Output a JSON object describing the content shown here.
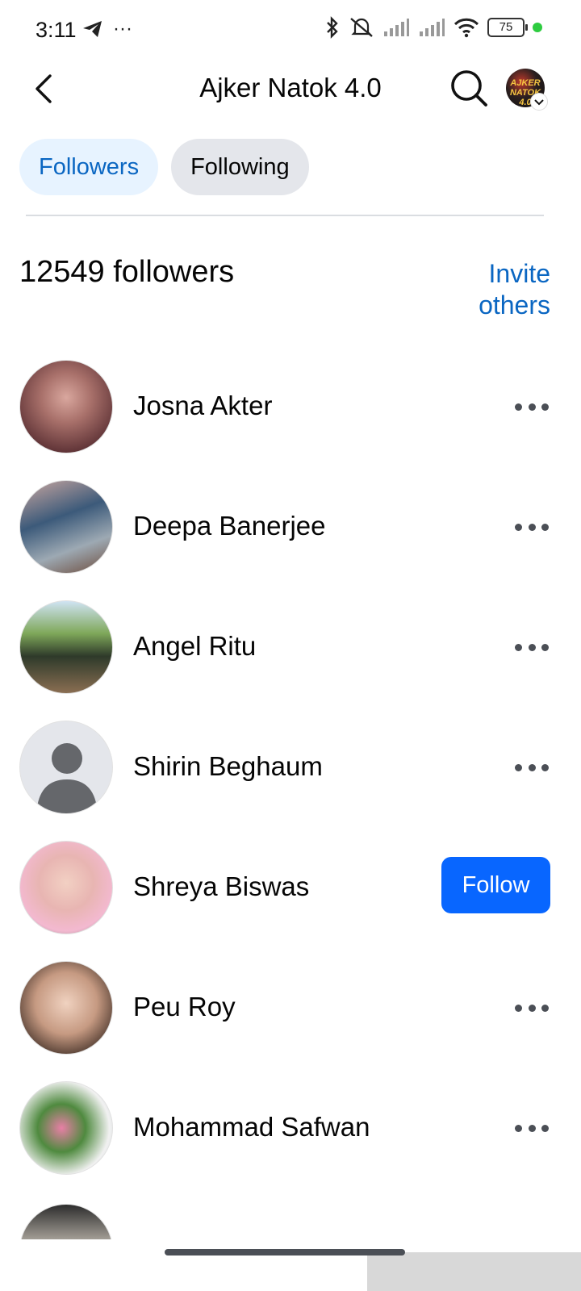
{
  "status_bar": {
    "time": "3:11",
    "overflow": "···",
    "battery": "75",
    "icons": [
      "telegram-icon",
      "bluetooth-icon",
      "mute-icon",
      "signal-icon",
      "signal-icon",
      "wifi-icon"
    ]
  },
  "header": {
    "title": "Ajker Natok 4.0",
    "profile_avatar_text": "AJKER NATOK 4.0"
  },
  "tabs": [
    {
      "label": "Followers",
      "active": true
    },
    {
      "label": "Following",
      "active": false
    }
  ],
  "followers": {
    "count_label": "12549 followers",
    "invite_line1": "Invite",
    "invite_line2": "others",
    "items": [
      {
        "name": "Josna Akter",
        "action": "more"
      },
      {
        "name": "Deepa Banerjee",
        "action": "more"
      },
      {
        "name": "Angel Ritu",
        "action": "more"
      },
      {
        "name": "Shirin Beghaum",
        "action": "more"
      },
      {
        "name": "Shreya Biswas",
        "action": "follow",
        "action_label": "Follow"
      },
      {
        "name": "Peu Roy",
        "action": "more"
      },
      {
        "name": "Mohammad Safwan",
        "action": "more"
      }
    ]
  },
  "colors": {
    "accent": "#0866ff",
    "link": "#0a66c2",
    "tab_active_bg": "#e7f3ff",
    "tab_inactive_bg": "#e4e6eb"
  }
}
